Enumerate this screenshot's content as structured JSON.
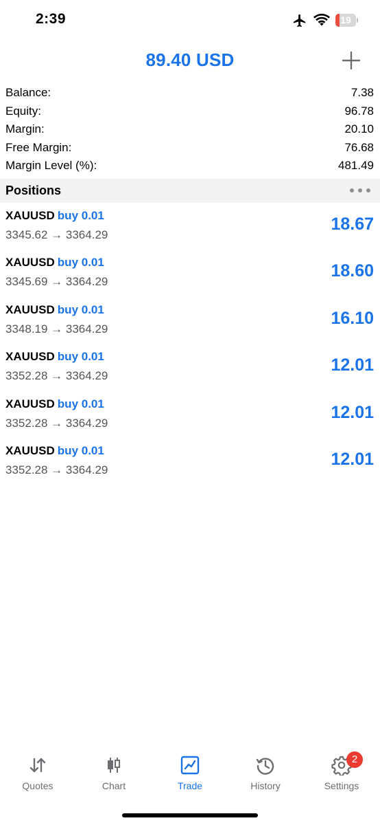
{
  "status_bar": {
    "time": "2:39",
    "battery": {
      "level_text": "19",
      "level_fraction": 0.19,
      "low_color": "#eb4e3d"
    }
  },
  "header": {
    "title": "89.40 USD",
    "accent_color": "#1a73e8",
    "add_icon": "plus-icon"
  },
  "summary": {
    "rows": [
      {
        "label": "Balance:",
        "value": "7.38"
      },
      {
        "label": "Equity:",
        "value": "96.78"
      },
      {
        "label": "Margin:",
        "value": "20.10"
      },
      {
        "label": "Free Margin:",
        "value": "76.68"
      },
      {
        "label": "Margin Level (%):",
        "value": "481.49"
      }
    ]
  },
  "positions": {
    "title": "Positions",
    "more_icon": "more-horizontal-icon",
    "items": [
      {
        "symbol": "XAUUSD",
        "type": "buy 0.01",
        "prices": "3345.62 → 3364.29",
        "profit": "18.67"
      },
      {
        "symbol": "XAUUSD",
        "type": "buy 0.01",
        "prices": "3345.69 → 3364.29",
        "profit": "18.60"
      },
      {
        "symbol": "XAUUSD",
        "type": "buy 0.01",
        "prices": "3348.19 → 3364.29",
        "profit": "16.10"
      },
      {
        "symbol": "XAUUSD",
        "type": "buy 0.01",
        "prices": "3352.28 → 3364.29",
        "profit": "12.01"
      },
      {
        "symbol": "XAUUSD",
        "type": "buy 0.01",
        "prices": "3352.28 → 3364.29",
        "profit": "12.01"
      },
      {
        "symbol": "XAUUSD",
        "type": "buy 0.01",
        "prices": "3352.28 → 3364.29",
        "profit": "12.01"
      }
    ]
  },
  "tab_bar": {
    "tabs": [
      {
        "label": "Quotes",
        "icon": "quotes-arrows-icon"
      },
      {
        "label": "Chart",
        "icon": "candlestick-chart-icon"
      },
      {
        "label": "Trade",
        "icon": "trade-chart-icon",
        "active": true
      },
      {
        "label": "History",
        "icon": "history-clock-icon"
      },
      {
        "label": "Settings",
        "icon": "gear-icon",
        "badge": "2"
      }
    ],
    "active_color": "#1a73e8",
    "inactive_color": "#6d6d72"
  }
}
